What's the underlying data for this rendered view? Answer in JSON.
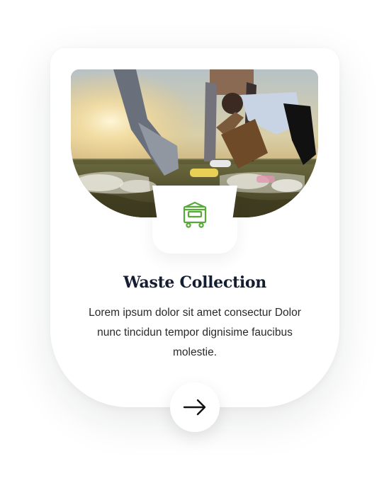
{
  "card": {
    "title": "Waste Collection",
    "description": "Lorem ipsum dolor sit amet consectur Dolor nunc tincidun tempor dignisime faucibus molestie.",
    "image_alt": "Volunteers collecting plastic waste at sunset",
    "service_icon": "dumpster-icon",
    "action_icon": "arrow-right-icon"
  },
  "colors": {
    "accent": "#5aa83a",
    "title": "#151d33",
    "text": "#2a2a2a"
  }
}
